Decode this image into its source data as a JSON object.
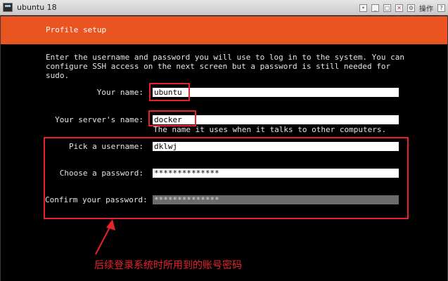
{
  "window": {
    "title": "ubuntu 18",
    "settings_label": "操作"
  },
  "header": {
    "title": "Profile setup"
  },
  "intro_text": "Enter the username and password you will use to log in to the system. You can\nconfigure SSH access on the next screen but a password is still needed for\nsudo.",
  "form": {
    "your_name": {
      "label": "Your name:",
      "value": "ubuntu"
    },
    "server_name": {
      "label": "Your server's name:",
      "value": "docker",
      "hint": "The name it uses when it talks to other computers."
    },
    "username": {
      "label": "Pick a username:",
      "value": "dklwj"
    },
    "password": {
      "label": "Choose a password:",
      "value": "**************"
    },
    "confirm_password": {
      "label": "Confirm your password:",
      "value": "**************"
    }
  },
  "annotation": {
    "text": "后续登录系统时所用到的账号密码",
    "color": "#e8222b"
  },
  "colors": {
    "accent": "#e95420",
    "background": "#000000"
  },
  "icons": {
    "app": "terminal-icon",
    "minimize": "minimize-icon",
    "maximize": "maximize-icon",
    "close": "close-icon"
  }
}
